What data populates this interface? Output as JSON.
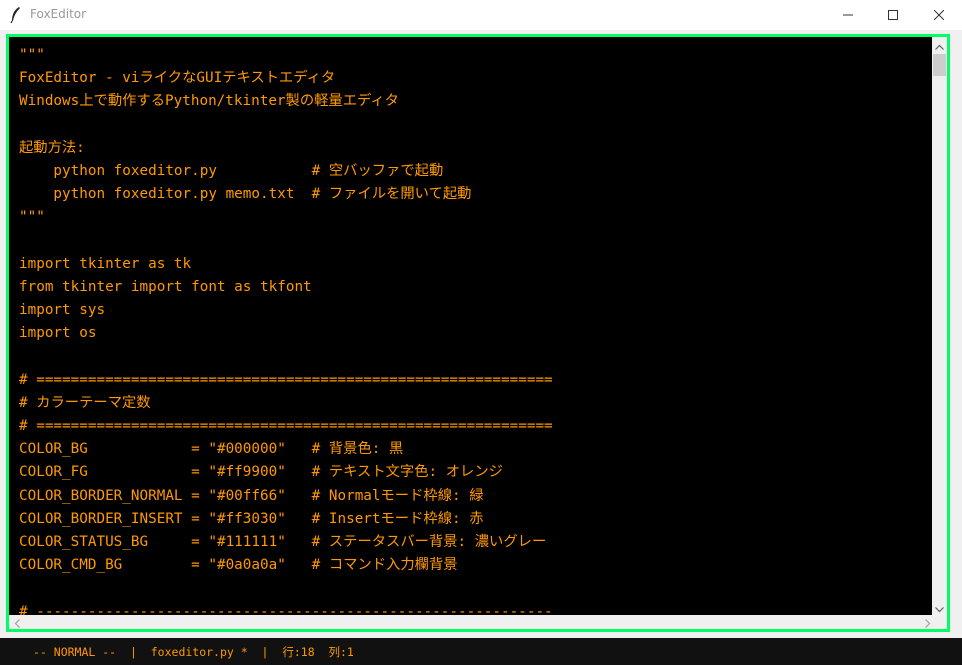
{
  "window": {
    "title": "FoxEditor"
  },
  "colors": {
    "background": "#000000",
    "foreground": "#ff9900",
    "border_normal": "#00ff66",
    "status_bg": "#111111"
  },
  "icons": {
    "app": "feather-icon",
    "minimize": "minimize-icon",
    "maximize": "maximize-icon",
    "close": "close-icon"
  },
  "editor": {
    "lines": [
      "\"\"\"",
      "FoxEditor - viライクなGUIテキストエディタ",
      "Windows上で動作するPython/tkinter製の軽量エディタ",
      "",
      "起動方法:",
      "    python foxeditor.py           # 空バッファで起動",
      "    python foxeditor.py memo.txt  # ファイルを開いて起動",
      "\"\"\"",
      "",
      "import tkinter as tk",
      "from tkinter import font as tkfont",
      "import sys",
      "import os",
      "",
      "# ============================================================",
      "# カラーテーマ定数",
      "# ============================================================",
      "COLOR_BG            = \"#000000\"   # 背景色: 黒",
      "COLOR_FG            = \"#ff9900\"   # テキスト文字色: オレンジ",
      "COLOR_BORDER_NORMAL = \"#00ff66\"   # Normalモード枠線: 緑",
      "COLOR_BORDER_INSERT = \"#ff3030\"   # Insertモード枠線: 赤",
      "COLOR_STATUS_BG     = \"#111111\"   # ステータスバー背景: 濃いグレー",
      "COLOR_CMD_BG        = \"#0a0a0a\"   # コマンド入力欄背景",
      "",
      "# ------------------------------------------------------------"
    ]
  },
  "statusbar": {
    "mode": "-- NORMAL --",
    "separator1": "|",
    "filename": "foxeditor.py *",
    "separator2": "|",
    "line": "行:18",
    "column": "列:1"
  }
}
